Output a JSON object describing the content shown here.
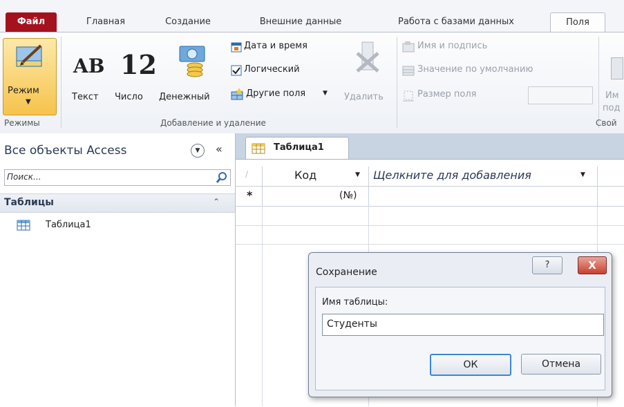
{
  "ribbon_tabs": [
    "Файл",
    "Главная",
    "Создание",
    "Внешние данные",
    "Работа с базами данных",
    "Поля"
  ],
  "ribbon": {
    "mode_label": "Режим",
    "group_modes": "Режимы",
    "text_glyph": "AB",
    "text_label": "Текст",
    "number_glyph": "12",
    "number_label": "Число",
    "currency_label": "Денежный",
    "datetime_label": "Дата и время",
    "boolean_label": "Логический",
    "other_fields_label": "Другие поля",
    "delete_label": "Удалить",
    "group_add_delete": "Добавление и удаление",
    "name_caption_label": "Имя и подпись",
    "default_value_label": "Значение по умолчанию",
    "field_size_label": "Размер поля",
    "cut_name_1": "Им",
    "cut_name_2": "под",
    "group_properties": "Свой"
  },
  "nav": {
    "title": "Все объекты Access",
    "search_placeholder": "Поиск...",
    "section": "Таблицы",
    "items": [
      "Таблица1"
    ]
  },
  "document": {
    "tab_label": "Таблица1",
    "columns": [
      "Код",
      "Щелкните для добавления"
    ],
    "new_row_marker": "*",
    "new_row_value": "(№)"
  },
  "dialog": {
    "title": "Сохранение",
    "field_label": "Имя таблицы:",
    "field_value": "Студенты",
    "ok_label": "ОК",
    "cancel_label": "Отмена",
    "help_label": "?",
    "close_label": "X"
  },
  "colors": {
    "file_tab": "#a4121e",
    "close_button": "#c9402f",
    "ok_focus": "#3b87d6",
    "mode_button": "#f8c85a"
  }
}
